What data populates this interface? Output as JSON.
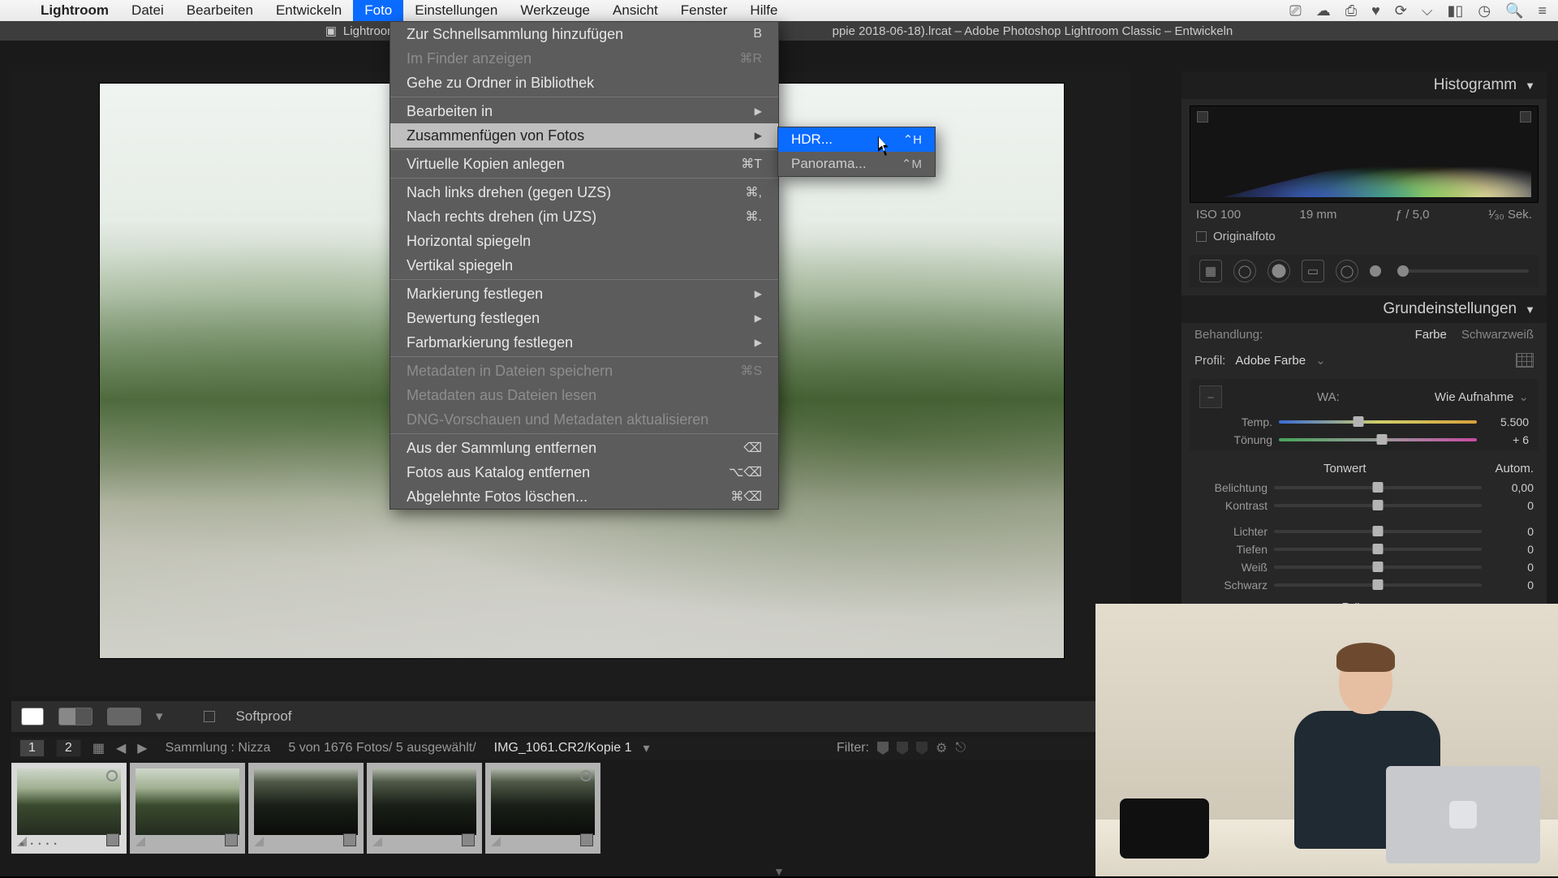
{
  "menubar": {
    "appname": "Lightroom",
    "items": [
      "Datei",
      "Bearbeiten",
      "Entwickeln",
      "Foto",
      "Einstellungen",
      "Werkzeuge",
      "Ansicht",
      "Fenster",
      "Hilfe"
    ],
    "active": "Foto"
  },
  "titlebar": {
    "doc": "Lightroom",
    "full": "ppie 2018-06-18).lrcat – Adobe Photoshop Lightroom Classic – Entwickeln"
  },
  "dropdown": {
    "items": [
      {
        "label": "Zur Schnellsammlung hinzufügen",
        "sc": "B"
      },
      {
        "label": "Im Finder anzeigen",
        "sc": "⌘R",
        "disabled": true
      },
      {
        "label": "Gehe zu Ordner in Bibliothek"
      },
      {
        "sep": true
      },
      {
        "label": "Bearbeiten in",
        "sub": true
      },
      {
        "label": "Zusammenfügen von Fotos",
        "sub": true,
        "hl": true
      },
      {
        "sep": true
      },
      {
        "label": "Virtuelle Kopien anlegen",
        "sc": "⌘T"
      },
      {
        "sep": true
      },
      {
        "label": "Nach links drehen (gegen UZS)",
        "sc": "⌘,"
      },
      {
        "label": "Nach rechts drehen (im UZS)",
        "sc": "⌘."
      },
      {
        "label": "Horizontal spiegeln"
      },
      {
        "label": "Vertikal spiegeln"
      },
      {
        "sep": true
      },
      {
        "label": "Markierung festlegen",
        "sub": true
      },
      {
        "label": "Bewertung festlegen",
        "sub": true
      },
      {
        "label": "Farbmarkierung festlegen",
        "sub": true
      },
      {
        "sep": true
      },
      {
        "label": "Metadaten in Dateien speichern",
        "sc": "⌘S",
        "disabled": true
      },
      {
        "label": "Metadaten aus Dateien lesen",
        "disabled": true
      },
      {
        "label": "DNG-Vorschauen und Metadaten aktualisieren",
        "disabled": true
      },
      {
        "sep": true
      },
      {
        "label": "Aus der Sammlung entfernen",
        "sc": "⌫"
      },
      {
        "label": "Fotos aus Katalog entfernen",
        "sc": "⌥⌫"
      },
      {
        "label": "Abgelehnte Fotos löschen...",
        "sc": "⌘⌫"
      }
    ]
  },
  "submenu": {
    "items": [
      {
        "label": "HDR...",
        "sc": "⌃H",
        "hl": true
      },
      {
        "label": "Panorama...",
        "sc": "⌃M"
      }
    ]
  },
  "softproof": "Softproof",
  "strip": {
    "pages": [
      "1",
      "2"
    ],
    "text1": "Sammlung : Nizza",
    "text2": "5 von 1676 Fotos/  5 ausgewählt/",
    "file": "IMG_1061.CR2/Kopie 1",
    "filter": "Filter:"
  },
  "hist": {
    "title": "Histogramm",
    "iso": "ISO 100",
    "fl": "19 mm",
    "ap": "ƒ / 5,0",
    "sh": "¹⁄₃₀ Sek.",
    "orig": "Originalfoto"
  },
  "grund": {
    "title": "Grundeinstellungen",
    "treat": "Behandlung:",
    "color": "Farbe",
    "bw": "Schwarzweiß",
    "profL": "Profil:",
    "profV": "Adobe Farbe",
    "wbL": "WA:",
    "wbV": "Wie Aufnahme",
    "temp": {
      "nm": "Temp.",
      "v": "5.500"
    },
    "tint": {
      "nm": "Tönung",
      "v": "+ 6"
    },
    "ton": "Tonwert",
    "auto": "Autom.",
    "sliders": [
      {
        "nm": "Belichtung",
        "v": "0,00"
      },
      {
        "nm": "Kontrast",
        "v": "0"
      },
      {
        "nm": "Lichter",
        "v": "0"
      },
      {
        "nm": "Tiefen",
        "v": "0"
      },
      {
        "nm": "Weiß",
        "v": "0"
      },
      {
        "nm": "Schwarz",
        "v": "0"
      }
    ],
    "pres": "Präsenz"
  }
}
